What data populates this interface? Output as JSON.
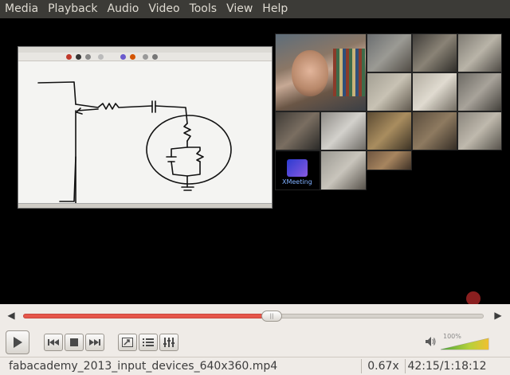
{
  "menu": {
    "items": [
      {
        "label": "Media"
      },
      {
        "label": "Playback"
      },
      {
        "label": "Audio"
      },
      {
        "label": "Video"
      },
      {
        "label": "Tools"
      },
      {
        "label": "View"
      },
      {
        "label": "Help"
      }
    ]
  },
  "playback": {
    "progress_fraction": 0.54,
    "volume_percent": "100%",
    "volume_fraction": 1.0
  },
  "status": {
    "filename": "fabacademy_2013_input_devices_640x360.mp4",
    "speed": "0.67x",
    "time": "42:15/1:18:12"
  },
  "video_overlay": {
    "xmeeting_label": "XMeeting"
  },
  "colors": {
    "menubar_bg": "#3c3b37",
    "seek_fill": "#e6564a",
    "controls_bg": "#efebe7"
  }
}
